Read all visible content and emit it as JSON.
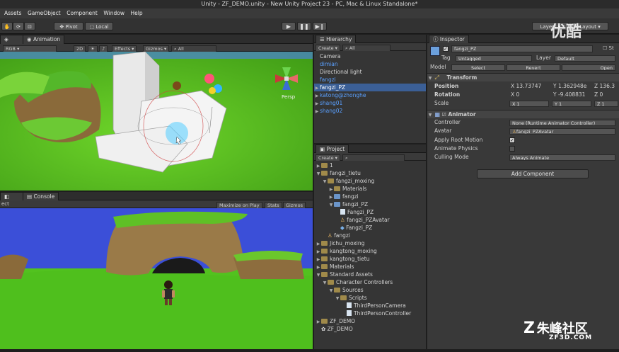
{
  "window": {
    "title": "Unity - ZF_DEMO.unity - New Unity Project 23 - PC, Mac & Linux Standalone*"
  },
  "menu": [
    "Assets",
    "GameObject",
    "Component",
    "Window",
    "Help"
  ],
  "toolbar": {
    "pivot": "Pivot",
    "local": "Local",
    "layers": "Layers",
    "layout": "Layout"
  },
  "scene_tabs": {
    "animation": "Animation"
  },
  "scene_bar": {
    "rgb": "RGB",
    "mode2d": "2D",
    "effects": "Effects",
    "gizmos": "Gizmos",
    "all": "All"
  },
  "scene_labels": {
    "persp": "Persp"
  },
  "game_tabs": {
    "console": "Console",
    "aspect": "ect"
  },
  "game_bar": {
    "maximize": "Maximize on Play",
    "stats": "Stats",
    "gizmos": "Gizmos"
  },
  "hierarchy": {
    "title": "Hierarchy",
    "create": "Create",
    "search": "All",
    "items": [
      {
        "label": "Camera",
        "color": "#d4d4d4",
        "expandable": false
      },
      {
        "label": "dimian",
        "color": "#5aa0ff",
        "expandable": false
      },
      {
        "label": "Directional light",
        "color": "#d4d4d4",
        "expandable": false
      },
      {
        "label": "fangzi",
        "color": "#5aa0ff",
        "expandable": false
      },
      {
        "label": "fangzi_PZ",
        "color": "#ffffff",
        "expandable": true,
        "selected": true
      },
      {
        "label": "katong@zhonghe",
        "color": "#5aa0ff",
        "expandable": true
      },
      {
        "label": "shang01",
        "color": "#5aa0ff",
        "expandable": true
      },
      {
        "label": "shang02",
        "color": "#5aa0ff",
        "expandable": true
      }
    ]
  },
  "project": {
    "title": "Project",
    "create": "Create",
    "items": [
      {
        "label": "1",
        "indent": 0,
        "type": "folder",
        "open": false
      },
      {
        "label": "fangzi_tietu",
        "indent": 0,
        "type": "folder",
        "open": true
      },
      {
        "label": "fangzi_moxing",
        "indent": 1,
        "type": "folder",
        "open": true
      },
      {
        "label": "Materials",
        "indent": 2,
        "type": "folder",
        "open": false
      },
      {
        "label": "fangzi",
        "indent": 2,
        "type": "model",
        "open": false
      },
      {
        "label": "fangzi_PZ",
        "indent": 2,
        "type": "model",
        "open": true
      },
      {
        "label": "Fangzi_PZ",
        "indent": 3,
        "type": "file"
      },
      {
        "label": "fangzi_PZAvatar",
        "indent": 3,
        "type": "avatar"
      },
      {
        "label": "Fangzi_PZ",
        "indent": 3,
        "type": "mesh"
      },
      {
        "label": "fangzi",
        "indent": 1,
        "type": "avatar"
      },
      {
        "label": "Jichu_moxing",
        "indent": 0,
        "type": "folder",
        "open": false
      },
      {
        "label": "kangtong_moxing",
        "indent": 0,
        "type": "folder",
        "open": false
      },
      {
        "label": "kangtong_tietu",
        "indent": 0,
        "type": "folder",
        "open": false
      },
      {
        "label": "Materials",
        "indent": 0,
        "type": "folder",
        "open": false
      },
      {
        "label": "Standard Assets",
        "indent": 0,
        "type": "folder",
        "open": true
      },
      {
        "label": "Character Controllers",
        "indent": 1,
        "type": "folder",
        "open": true
      },
      {
        "label": "Sources",
        "indent": 2,
        "type": "folder",
        "open": true
      },
      {
        "label": "Scripts",
        "indent": 3,
        "type": "folder",
        "open": true
      },
      {
        "label": "ThirdPersonCamera",
        "indent": 4,
        "type": "file"
      },
      {
        "label": "ThirdPersonController",
        "indent": 4,
        "type": "file"
      },
      {
        "label": "ZF_DEMO",
        "indent": 0,
        "type": "folder",
        "open": false
      },
      {
        "label": "ZF_DEMO",
        "indent": 0,
        "type": "scene"
      }
    ]
  },
  "inspector": {
    "title": "Inspector",
    "object_name": "fangzi_PZ",
    "static_label": "St",
    "tag_label": "Tag",
    "tag_value": "Untagged",
    "layer_label": "Layer",
    "layer_value": "Default",
    "model_label": "Model",
    "select": "Select",
    "revert": "Revert",
    "open": "Open",
    "transform": {
      "title": "Transform",
      "position": {
        "label": "Position",
        "x": "X 13.73747",
        "y": "Y 1.362948e",
        "z": "Z 136.3"
      },
      "rotation": {
        "label": "Rotation",
        "x": "X 0",
        "y": "Y -9.408831",
        "z": "Z 0"
      },
      "scale": {
        "label": "Scale",
        "x": "X 1",
        "y": "Y 1",
        "z": "Z 1"
      }
    },
    "animator": {
      "title": "Animator",
      "controller_label": "Controller",
      "controller_value": "None (Runtime Animator Controller)",
      "avatar_label": "Avatar",
      "avatar_value": "fangzi_PZAvatar",
      "root_motion_label": "Apply Root Motion",
      "animate_physics_label": "Animate Physics",
      "culling_label": "Culling Mode",
      "culling_value": "Always Animate"
    },
    "add_component": "Add Component"
  },
  "watermarks": {
    "top": "优酷",
    "bottom": "朱峰社区",
    "site": "ZF3D.COM"
  }
}
